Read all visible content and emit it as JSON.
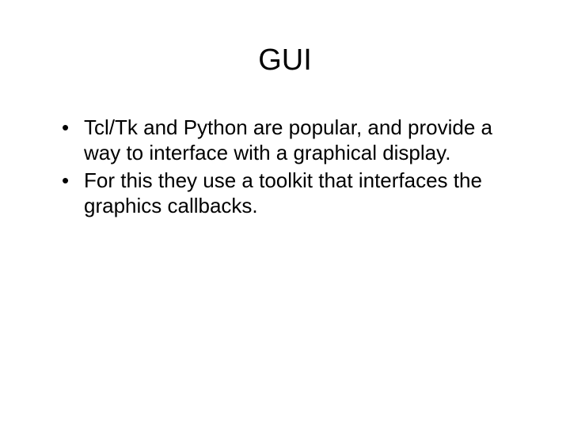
{
  "slide": {
    "title": "GUI",
    "bullets": [
      "Tcl/Tk and Python are popular, and provide a way to interface with a graphical display.",
      "For this they use a toolkit that interfaces the graphics callbacks."
    ]
  }
}
